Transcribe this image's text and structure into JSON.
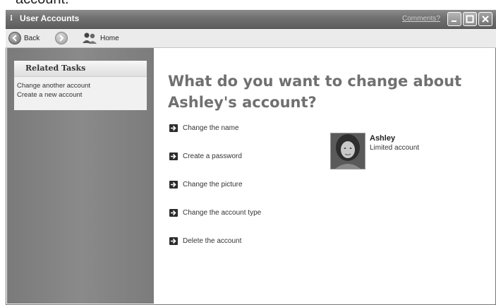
{
  "caption_fragment": "account.",
  "window": {
    "title": "User Accounts",
    "title_link": "Comments?"
  },
  "toolbar": {
    "back_label": "Back",
    "home_label": "Home"
  },
  "related_tasks": {
    "heading": "Related Tasks",
    "links": [
      "Change another account",
      "Create a new account"
    ]
  },
  "main": {
    "heading_line1": "What do you want to change about",
    "heading_line2": "Ashley's account?",
    "options": [
      "Change the name",
      "Create a password",
      "Change the picture",
      "Change the account type",
      "Delete the account"
    ]
  },
  "account": {
    "name": "Ashley",
    "type": "Limited account"
  },
  "icons": [
    "user-accounts-icon",
    "minimize-icon",
    "maximize-icon",
    "close-icon",
    "back-arrow-icon",
    "forward-arrow-icon",
    "users-icon",
    "arrow-right-icon"
  ]
}
